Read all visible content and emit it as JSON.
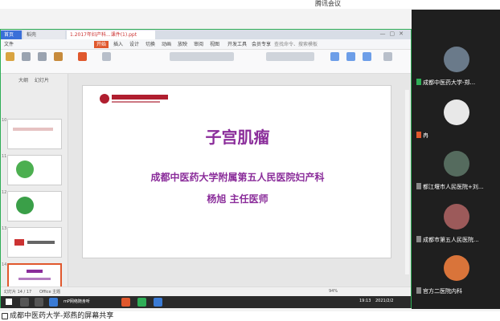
{
  "meeting": {
    "title": "腾讯会议"
  },
  "share_window": {
    "tabs": [
      {
        "label": "首页"
      },
      {
        "label": "稻壳"
      },
      {
        "label": "1.2017年妇产科...课件(1).ppt"
      }
    ],
    "ribbon_tabs": [
      "文件",
      "开始",
      "插入",
      "设计",
      "切换",
      "动画",
      "放映",
      "审阅",
      "视图",
      "开发工具",
      "会员专享"
    ],
    "active_ribbon_tab": "开始",
    "search_placeholder": "查找命令、搜索模板",
    "pane_tabs": [
      "大纲",
      "幻灯片"
    ],
    "slide_numbers": [
      "10",
      "11",
      "12",
      "13",
      "14"
    ],
    "status": {
      "slide_pos": "幻灯片 14 / 17",
      "theme": "Office 主题",
      "zoom": "94%"
    },
    "taskbar": {
      "time": "19:13",
      "date": "2021/2/2",
      "item_label": "mP网络随身听"
    }
  },
  "slide": {
    "title": "子宫肌瘤",
    "hospital": "成都中医药大学附属第五人民医院妇产科",
    "presenter": "杨旭    主任医师"
  },
  "participants": [
    {
      "name": "成都中医药大学-郑..."
    },
    {
      "name": "冉"
    },
    {
      "name": "都江堰市人民医院+刘..."
    },
    {
      "name": "成都市第五人民医院..."
    },
    {
      "name": "官方二医院内科"
    }
  ],
  "footer": {
    "label": "成都中医药大学-郑燕的屏幕共享"
  },
  "colors": {
    "accent_green": "#2fae57",
    "slide_purple": "#8a2c9a",
    "wps_orange": "#e0582d"
  }
}
